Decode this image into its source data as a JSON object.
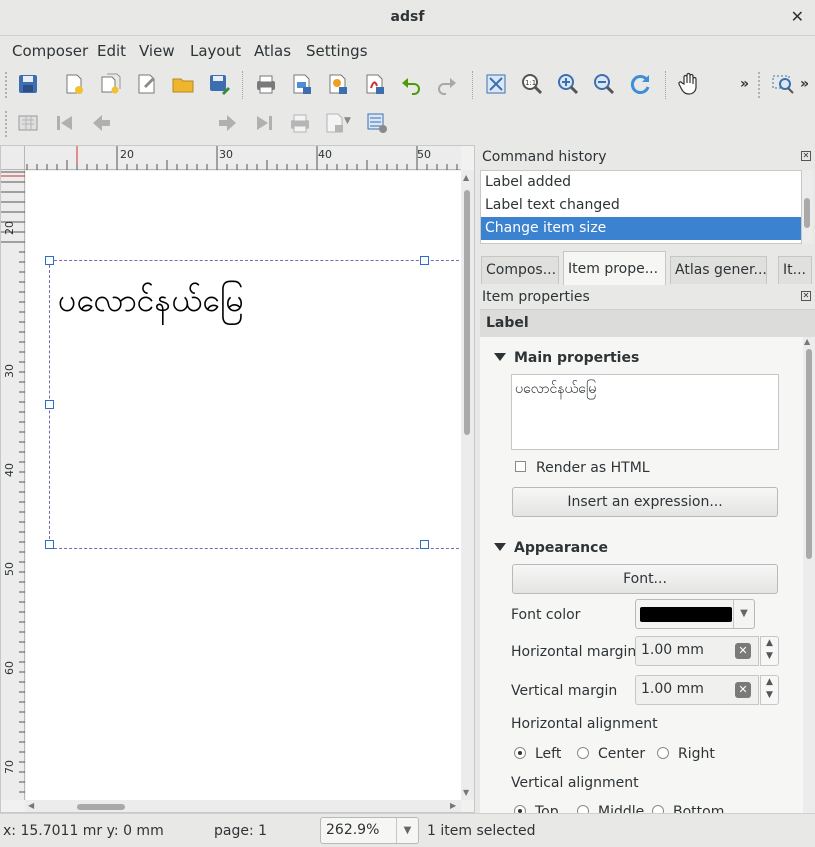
{
  "window": {
    "title": "adsf",
    "close_glyph": "✕"
  },
  "menubar": {
    "items": [
      "Composer",
      "Edit",
      "View",
      "Layout",
      "Atlas",
      "Settings"
    ]
  },
  "toolbar2": {
    "page_value": "1"
  },
  "canvas": {
    "label_text": "ပလောင်နယ်မြေ",
    "hruler_labels": [
      "20",
      "30",
      "40",
      "50"
    ],
    "vruler_labels": [
      "20",
      "30",
      "40",
      "50",
      "60",
      "70"
    ]
  },
  "command_history": {
    "title": "Command history",
    "items": [
      "Label added",
      "Label text changed",
      "Change item size"
    ],
    "selected_index": 2
  },
  "tabs": [
    "Compos...",
    "Item prope...",
    "Atlas gener...",
    "It..."
  ],
  "item_properties": {
    "title": "Item properties",
    "section": "Label",
    "main_group": "Main properties",
    "label_text": "ပလောင်နယ်မြေ",
    "render_html_label": "Render as HTML",
    "insert_expression_label": "Insert an expression...",
    "appearance_group": "Appearance",
    "font_button": "Font...",
    "font_color_label": "Font color",
    "font_color": "#000000",
    "hmargin_label": "Horizontal margin",
    "hmargin_value": "1.00 mm",
    "vmargin_label": "Vertical margin",
    "vmargin_value": "1.00 mm",
    "halign_label": "Horizontal alignment",
    "halign_options": [
      "Left",
      "Center",
      "Right"
    ],
    "halign_selected": "Left",
    "valign_label": "Vertical alignment",
    "valign_options": [
      "Top",
      "Middle",
      "Bottom"
    ],
    "valign_selected": "Top"
  },
  "status": {
    "coords": "x: 15.7011 mr y: 0 mm",
    "page": "page: 1",
    "zoom": "262.9%",
    "selection": "1 item selected"
  },
  "colors": {
    "selection": "#3b82d0",
    "accent_handle": "#2d6ec5"
  }
}
